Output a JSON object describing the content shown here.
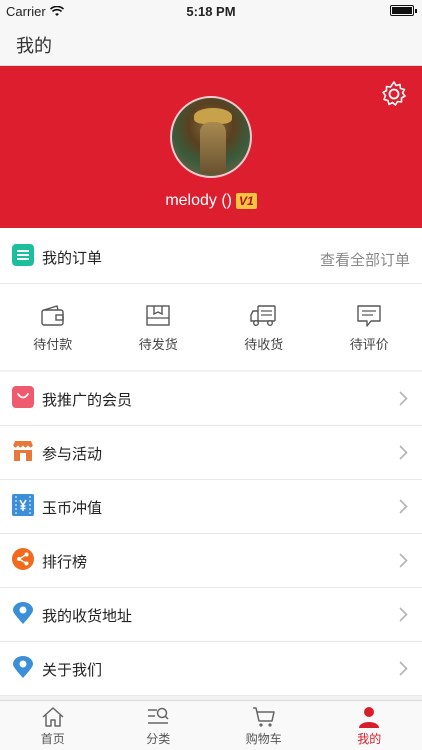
{
  "status": {
    "carrier": "Carrier",
    "time": "5:18 PM"
  },
  "nav": {
    "title": "我的"
  },
  "profile": {
    "username": "melody ()",
    "vip_badge": "V1"
  },
  "orders": {
    "title": "我的订单",
    "view_all": "查看全部订单",
    "statuses": [
      {
        "label": "待付款",
        "icon": "wallet-icon"
      },
      {
        "label": "待发货",
        "icon": "package-icon"
      },
      {
        "label": "待收货",
        "icon": "truck-icon"
      },
      {
        "label": "待评价",
        "icon": "comment-icon"
      }
    ]
  },
  "menu": [
    {
      "label": "我推广的会员",
      "icon": "shopping-bag-icon",
      "color": "#f05a6e"
    },
    {
      "label": "参与活动",
      "icon": "store-icon",
      "color": "#e8783a"
    },
    {
      "label": "玉币冲值",
      "icon": "yen-icon",
      "color": "#3a8fd8"
    },
    {
      "label": "排行榜",
      "icon": "share-icon",
      "color": "#f26a1b"
    },
    {
      "label": "我的收货地址",
      "icon": "location-pin-icon",
      "color": "#3a8fd8"
    },
    {
      "label": "关于我们",
      "icon": "location-pin-icon",
      "color": "#3a8fd8"
    }
  ],
  "tabbar": [
    {
      "label": "首页",
      "icon": "home-icon",
      "active": false
    },
    {
      "label": "分类",
      "icon": "category-search-icon",
      "active": false
    },
    {
      "label": "购物车",
      "icon": "cart-icon",
      "active": false
    },
    {
      "label": "我的",
      "icon": "user-icon",
      "active": true
    }
  ],
  "colors": {
    "brand_red": "#dc1e2e",
    "active_tab": "#d81e2a",
    "order_icon": "#1bbf9c"
  }
}
